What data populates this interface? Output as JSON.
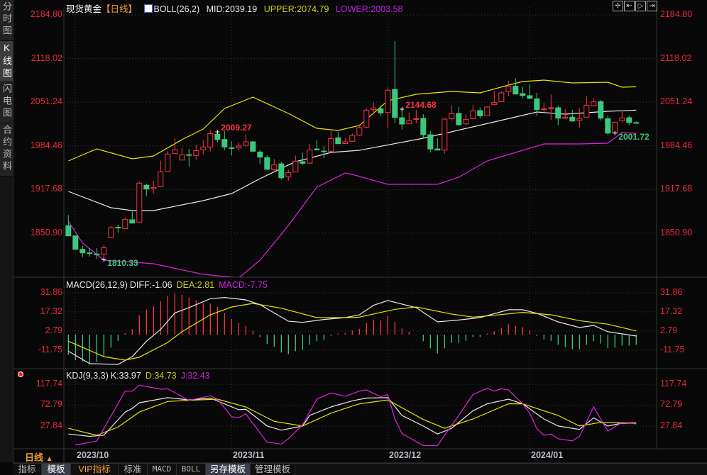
{
  "sidebar": {
    "tabs": [
      {
        "label": "分时图",
        "chars": [
          "分",
          "时",
          "图"
        ]
      },
      {
        "label": "K线图",
        "chars": [
          "K",
          "线",
          "图"
        ],
        "active": true
      },
      {
        "label": "闪电图",
        "chars": [
          "闪",
          "电",
          "图"
        ]
      },
      {
        "label": "合约资料",
        "chars": [
          "合",
          "约",
          "资",
          "料"
        ]
      }
    ]
  },
  "header": {
    "symbol": "现货黄金",
    "period": "【日线】",
    "boll_name": "BOLL(26,2)",
    "mid": "MID:2039.19",
    "upper": "UPPER:2074.79",
    "lower": "LOWER:2003.58"
  },
  "toolbar": {
    "icons": [
      "crosshair-icon",
      "zoom-in-range-icon",
      "play-forward-icon",
      "move-right-icon"
    ]
  },
  "colors": {
    "up": "#ff3344",
    "down": "#3cc87c",
    "mid": "#e8e8e8",
    "upper": "#e6e600",
    "lower": "#e020e0",
    "axis_text": "#e8283c",
    "grid": "#3a3a3a"
  },
  "main": {
    "y_ticks": [
      "2184.80",
      "2118.02",
      "2051.24",
      "1984.46",
      "1917.68",
      "1850.90"
    ],
    "y_range": [
      1850.9,
      2184.8
    ],
    "annotations": [
      {
        "label": "2144.68",
        "index": 47,
        "kind": "high"
      },
      {
        "label": "2009.27",
        "index": 21,
        "kind": "high"
      },
      {
        "label": "1810.33",
        "index": 5,
        "kind": "low"
      },
      {
        "label": "2001.72",
        "index": 77,
        "kind": "low"
      }
    ],
    "candles": [
      [
        1862.3,
        1846.8,
        1878.6,
        1846.1
      ],
      [
        1846.8,
        1826.2,
        1846.8,
        1826.2
      ],
      [
        1826.2,
        1820.8,
        1831.6,
        1814.3
      ],
      [
        1820.8,
        1820.0,
        1828,
        1815
      ],
      [
        1819,
        1818.5,
        1828,
        1811.8
      ],
      [
        1819,
        1828.7,
        1833.4,
        1810.33
      ],
      [
        1844.3,
        1859.5,
        1862.3,
        1843.6
      ],
      [
        1860,
        1859,
        1864,
        1852
      ],
      [
        1857.6,
        1872.1,
        1875,
        1857.6
      ],
      [
        1871.4,
        1866.3,
        1884,
        1866.3
      ],
      [
        1867.8,
        1927.4,
        1929.9,
        1867.8
      ],
      [
        1924.2,
        1918.4,
        1926.7,
        1907.5
      ],
      [
        1919.1,
        1920.9,
        1931,
        1911.9
      ],
      [
        1922,
        1944.8,
        1961.8,
        1922
      ],
      [
        1945.5,
        1971.9,
        1976.2,
        1945.5
      ],
      [
        1972.6,
        1978.4,
        1996,
        1971.9
      ],
      [
        1962.8,
        1970.8,
        1981.6,
        1962.8
      ],
      [
        1971,
        1970,
        1979.8,
        1952.7
      ],
      [
        1969.7,
        1977.3,
        1986.3,
        1962.8
      ],
      [
        1978.4,
        1982.7,
        1992.8,
        1971.5
      ],
      [
        1982.7,
        2003.3,
        2009.27,
        1976.2
      ],
      [
        2002.2,
        1994.3,
        2005.9,
        1990
      ],
      [
        1994.3,
        1982.7,
        2007,
        1978
      ],
      [
        1981.5,
        1981,
        1991.4,
        1969.7
      ],
      [
        1981.3,
        1984.2,
        1989.6,
        1978
      ],
      [
        1985.3,
        1990.7,
        2002.2,
        1982.7
      ],
      [
        1990.7,
        1976.2,
        1991.8,
        1976.2
      ],
      [
        1975.1,
        1967.2,
        1978,
        1956.3
      ],
      [
        1966.5,
        1948.7,
        1969.7,
        1947.3
      ],
      [
        1948,
        1955.3,
        1964.3,
        1944.4
      ],
      [
        1957,
        1935.7,
        1960,
        1932.8
      ],
      [
        1937.2,
        1943.7,
        1948,
        1931
      ],
      [
        1944.4,
        1961,
        1969.7,
        1943.7
      ],
      [
        1960.3,
        1957.8,
        1974.4,
        1955.3
      ],
      [
        1958.1,
        1978.4,
        1987.8,
        1956.3
      ],
      [
        1979.8,
        1978.4,
        1992.8,
        1978
      ],
      [
        1976.5,
        1976,
        1984,
        1965.4
      ],
      [
        1976.2,
        1995.7,
        2007,
        1976.2
      ],
      [
        1996.8,
        1987.8,
        2005.9,
        1987.1
      ],
      [
        1988,
        1990.7,
        1996.8,
        1988
      ],
      [
        1991.4,
        2000.4,
        2003.3,
        1991.4
      ],
      [
        2000.8,
        2012.4,
        2014.2,
        1999.7
      ],
      [
        2013.1,
        2039.1,
        2042,
        2011.6
      ],
      [
        2039.8,
        2042.4,
        2051,
        2034
      ],
      [
        2041.3,
        2034.8,
        2046,
        2031.2
      ],
      [
        2035.5,
        2069.5,
        2073.8,
        2011.6
      ],
      [
        2070.9,
        2027.9,
        2144.68,
        2019.6
      ],
      [
        2027.5,
        2017.8,
        2040.6,
        2009.5
      ],
      [
        2018.2,
        2023.2,
        2035.1,
        2018.2
      ],
      [
        2025,
        2026,
        2039.5,
        2018.9
      ],
      [
        2026.5,
        2001.5,
        2033,
        1995
      ],
      [
        2001.5,
        1979.8,
        2007,
        1974.4
      ],
      [
        1979.8,
        1978,
        1996,
        1978
      ],
      [
        1978,
        2025.4,
        2026.8,
        1972.6
      ],
      [
        2026.1,
        2033.7,
        2046.7,
        2023.2
      ],
      [
        2034.1,
        2016.7,
        2044.2,
        2015.3
      ],
      [
        2018.2,
        2025,
        2033,
        2016
      ],
      [
        2026.1,
        2038,
        2046.7,
        2025
      ],
      [
        2038.4,
        2030.4,
        2043.1,
        2026.8
      ],
      [
        2030.4,
        2043.8,
        2044.9,
        2029.7
      ],
      [
        2047.8,
        2051,
        2068.4,
        2046.7
      ],
      [
        2052.1,
        2065.5,
        2068.4,
        2052.1
      ],
      [
        2067.3,
        2075.6,
        2084,
        2060.8
      ],
      [
        2075.6,
        2063.7,
        2087.6,
        2063.7
      ],
      [
        2064.4,
        2061.5,
        2074.6,
        2057.2
      ],
      [
        2061.2,
        2057.2,
        2078.5,
        2055.8
      ],
      [
        2056.5,
        2039.8,
        2065.5,
        2030.4
      ],
      [
        2040,
        2041,
        2050.3,
        2035.9
      ],
      [
        2042,
        2042.7,
        2063,
        2024
      ],
      [
        2042.7,
        2026.8,
        2046,
        2016
      ],
      [
        2026.8,
        2028.3,
        2040.2,
        2026.1
      ],
      [
        2028.3,
        2022.5,
        2039.5,
        2021.4
      ],
      [
        2023.2,
        2026.5,
        2042.4,
        2012.4
      ],
      [
        2028.3,
        2046.7,
        2061.2,
        2027.9
      ],
      [
        2046,
        2051.8,
        2057.6,
        2044.9
      ],
      [
        2052.1,
        2026.8,
        2054.7,
        2023.2
      ],
      [
        2026.1,
        2004,
        2031,
        2001.72
      ],
      [
        2004.4,
        2020.7,
        2021.4,
        2004
      ],
      [
        2022.8,
        2027.2,
        2038.8,
        2020.7
      ],
      [
        2027.5,
        2020.3,
        2031,
        2016
      ],
      [
        2020,
        2019.6,
        2022,
        2019
      ]
    ],
    "boll_upper": [
      [
        0,
        1961.4
      ],
      [
        4,
        1979.8
      ],
      [
        9,
        1964.7
      ],
      [
        12,
        1969
      ],
      [
        16,
        1993.9
      ],
      [
        19,
        2010.2
      ],
      [
        22,
        2041.7
      ],
      [
        26,
        2059
      ],
      [
        31,
        2034.1
      ],
      [
        35,
        2011.3
      ],
      [
        38,
        2008
      ],
      [
        41,
        2015.6
      ],
      [
        45,
        2053.6
      ],
      [
        49,
        2063.3
      ],
      [
        54,
        2067.7
      ],
      [
        58,
        2065.5
      ],
      [
        62,
        2077.4
      ],
      [
        64,
        2082.9
      ],
      [
        67,
        2085
      ],
      [
        71,
        2080.7
      ],
      [
        76,
        2081.8
      ],
      [
        78,
        2074.2
      ],
      [
        80,
        2074.79
      ]
    ],
    "boll_mid": [
      [
        0,
        1914.8
      ],
      [
        6,
        1889.8
      ],
      [
        9,
        1885.5
      ],
      [
        12,
        1885.5
      ],
      [
        19,
        1900.7
      ],
      [
        23,
        1911.5
      ],
      [
        27,
        1934.3
      ],
      [
        32,
        1960.3
      ],
      [
        34,
        1965.7
      ],
      [
        37,
        1974.4
      ],
      [
        41,
        1977.7
      ],
      [
        50,
        1996.1
      ],
      [
        60,
        2021.1
      ],
      [
        66,
        2036.2
      ],
      [
        70,
        2033
      ],
      [
        76,
        2037.3
      ],
      [
        80,
        2039.19
      ]
    ],
    "boll_lower": [
      [
        0,
        1869.2
      ],
      [
        2,
        1835.6
      ],
      [
        5,
        1809.6
      ],
      [
        12,
        1804.2
      ],
      [
        19,
        1787.9
      ],
      [
        24,
        1782.5
      ],
      [
        27,
        1809.6
      ],
      [
        31,
        1862.7
      ],
      [
        35,
        1921.3
      ],
      [
        39,
        1943
      ],
      [
        40,
        1940.8
      ],
      [
        45,
        1925.6
      ],
      [
        52,
        1925.6
      ],
      [
        55,
        1936.5
      ],
      [
        59,
        1961.4
      ],
      [
        64,
        1977.7
      ],
      [
        67,
        1987.4
      ],
      [
        72,
        1987.4
      ],
      [
        76,
        1988.5
      ],
      [
        78,
        2004.8
      ],
      [
        80,
        2003.58
      ]
    ]
  },
  "macd": {
    "legend": {
      "name": "MACD(26,12,9)",
      "diff": "DIFF:-1.06",
      "dea": "DEA:2.81",
      "macd": "MACD:-7.75"
    },
    "y_ticks": [
      "31.86",
      "17.32",
      "2.79",
      "-11.75"
    ],
    "hist": [
      -15.3,
      -19.4,
      -20.3,
      -21.5,
      -20.8,
      -17,
      -9.9,
      -4.7,
      1.3,
      4.3,
      14.7,
      19,
      21.7,
      25.5,
      29.6,
      31.2,
      30.3,
      28.2,
      26,
      24,
      23.7,
      21,
      16.3,
      12,
      8.8,
      6.6,
      2.9,
      -1.8,
      -7.2,
      -9.2,
      -13.6,
      -14.9,
      -12.6,
      -11.7,
      -7.7,
      -5,
      -4.1,
      -0.9,
      0.9,
      1.3,
      3.1,
      4.4,
      8.8,
      11.5,
      10.8,
      14.2,
      9.7,
      4.8,
      2.2,
      -0.2,
      -5,
      -10.4,
      -14.4,
      -10.4,
      -6.3,
      -6.3,
      -4.7,
      -1.8,
      -1.8,
      0.9,
      2.5,
      5.2,
      7.9,
      6.6,
      5.7,
      3.4,
      -0.9,
      -3.6,
      -4.7,
      -7.7,
      -9.5,
      -11,
      -11,
      -7.7,
      -5,
      -6.8,
      -10.4,
      -9.9,
      -8.3,
      -8.3,
      -7.75
    ],
    "diff": [
      [
        0,
        -12.6
      ],
      [
        3,
        -22
      ],
      [
        7,
        -22.6
      ],
      [
        9,
        -16.7
      ],
      [
        11,
        -5
      ],
      [
        13,
        4
      ],
      [
        15,
        16.5
      ],
      [
        17,
        20.5
      ],
      [
        20,
        27.3
      ],
      [
        22,
        28.2
      ],
      [
        25,
        26.4
      ],
      [
        27,
        22.8
      ],
      [
        31,
        10.2
      ],
      [
        33,
        9.3
      ],
      [
        36,
        11.5
      ],
      [
        39,
        12.9
      ],
      [
        41,
        15
      ],
      [
        43,
        22.3
      ],
      [
        45,
        25.9
      ],
      [
        49,
        20.5
      ],
      [
        52,
        9.7
      ],
      [
        55,
        11.1
      ],
      [
        58,
        12.9
      ],
      [
        62,
        18.9
      ],
      [
        64,
        18.9
      ],
      [
        66,
        16.2
      ],
      [
        69,
        9.7
      ],
      [
        72,
        5.4
      ],
      [
        74,
        7
      ],
      [
        76,
        2.2
      ],
      [
        80,
        -1.06
      ]
    ],
    "dea": [
      [
        0,
        -5
      ],
      [
        5,
        -16.7
      ],
      [
        8,
        -19.4
      ],
      [
        10,
        -17.2
      ],
      [
        14,
        -5.9
      ],
      [
        16,
        2.2
      ],
      [
        20,
        15.1
      ],
      [
        23,
        21
      ],
      [
        26,
        23.7
      ],
      [
        30,
        20.1
      ],
      [
        35,
        12.9
      ],
      [
        40,
        12.9
      ],
      [
        41,
        13.3
      ],
      [
        46,
        19.2
      ],
      [
        49,
        21
      ],
      [
        54,
        15.6
      ],
      [
        57,
        13.3
      ],
      [
        60,
        14.7
      ],
      [
        64,
        16.9
      ],
      [
        68,
        15.1
      ],
      [
        72,
        10.6
      ],
      [
        76,
        7.9
      ],
      [
        80,
        2.81
      ]
    ]
  },
  "kdj": {
    "legend": {
      "name": "KDJ(9,3,3)",
      "k": "K:33.97",
      "d": "D:34.73",
      "j": "J:32.43"
    },
    "y_ticks": [
      "117.74",
      "72.79",
      "27.84"
    ],
    "k": [
      [
        0,
        10.7
      ],
      [
        3,
        5.7
      ],
      [
        5,
        8.2
      ],
      [
        8,
        58
      ],
      [
        9,
        65.7
      ],
      [
        10,
        78
      ],
      [
        14,
        89
      ],
      [
        17,
        84
      ],
      [
        20,
        88
      ],
      [
        24,
        63
      ],
      [
        25,
        64
      ],
      [
        28,
        28
      ],
      [
        30,
        19
      ],
      [
        33,
        28
      ],
      [
        34,
        50.7
      ],
      [
        37,
        69
      ],
      [
        40,
        82
      ],
      [
        42,
        88
      ],
      [
        45,
        89
      ],
      [
        47,
        50.7
      ],
      [
        50,
        28
      ],
      [
        52,
        10.7
      ],
      [
        54,
        23
      ],
      [
        57,
        60.7
      ],
      [
        59,
        75.7
      ],
      [
        62,
        85.7
      ],
      [
        64,
        75.7
      ],
      [
        67,
        43
      ],
      [
        69,
        28
      ],
      [
        72,
        20.7
      ],
      [
        74,
        45.7
      ],
      [
        76,
        28
      ],
      [
        78,
        34
      ],
      [
        80,
        33.97
      ]
    ],
    "d": [
      [
        0,
        23
      ],
      [
        4,
        8
      ],
      [
        7,
        25.7
      ],
      [
        10,
        58
      ],
      [
        14,
        80.7
      ],
      [
        17,
        83.2
      ],
      [
        21,
        85.7
      ],
      [
        25,
        69
      ],
      [
        29,
        38
      ],
      [
        33,
        28
      ],
      [
        37,
        55.7
      ],
      [
        41,
        75.7
      ],
      [
        45,
        84
      ],
      [
        50,
        42
      ],
      [
        53,
        23
      ],
      [
        57,
        43
      ],
      [
        62,
        75.7
      ],
      [
        64,
        75.7
      ],
      [
        69,
        50.7
      ],
      [
        72,
        28
      ],
      [
        75,
        35.7
      ],
      [
        80,
        34.73
      ]
    ],
    "j": [
      [
        1,
        -12.8
      ],
      [
        4,
        -4.3
      ],
      [
        8,
        103
      ],
      [
        9,
        103
      ],
      [
        10,
        115.7
      ],
      [
        13,
        107
      ],
      [
        14,
        108
      ],
      [
        17,
        83
      ],
      [
        20,
        93
      ],
      [
        21,
        85.7
      ],
      [
        23,
        48
      ],
      [
        24,
        45.7
      ],
      [
        25,
        54
      ],
      [
        28,
        -6.8
      ],
      [
        30,
        -10.8
      ],
      [
        31,
        0.7
      ],
      [
        33,
        30.7
      ],
      [
        35,
        85.7
      ],
      [
        37,
        99
      ],
      [
        39,
        92
      ],
      [
        41,
        103
      ],
      [
        42,
        105.7
      ],
      [
        44,
        90.7
      ],
      [
        45,
        95.7
      ],
      [
        46,
        43
      ],
      [
        47,
        12
      ],
      [
        50,
        -14.3
      ],
      [
        52,
        -14
      ],
      [
        55,
        50.7
      ],
      [
        57,
        95.7
      ],
      [
        59,
        109
      ],
      [
        60,
        103
      ],
      [
        61,
        108
      ],
      [
        62,
        105.7
      ],
      [
        64,
        75.7
      ],
      [
        65,
        55.7
      ],
      [
        66,
        22
      ],
      [
        67,
        8
      ],
      [
        68,
        10.7
      ],
      [
        69,
        0.7
      ],
      [
        71,
        -4
      ],
      [
        72,
        5.7
      ],
      [
        74,
        69
      ],
      [
        76,
        17
      ],
      [
        78,
        35.7
      ],
      [
        80,
        32.43
      ]
    ]
  },
  "x_axis": {
    "labels": [
      {
        "text": "2023/10",
        "index": 1
      },
      {
        "text": "2023/11",
        "index": 23
      },
      {
        "text": "2023/12",
        "index": 45
      },
      {
        "text": "2024/01",
        "index": 65
      }
    ]
  },
  "period_selector": {
    "label": "日线",
    "arrow": "▲"
  },
  "bottom_tabs": [
    {
      "label": "指标"
    },
    {
      "label": "模板",
      "selected": true
    },
    {
      "label": "VIP指标",
      "vip": true
    },
    {
      "label": "标准"
    },
    {
      "label": "MACD",
      "mono": true
    },
    {
      "label": "BOLL",
      "mono": true
    },
    {
      "label": "另存模板",
      "selected": true
    },
    {
      "label": "管理模板"
    }
  ]
}
